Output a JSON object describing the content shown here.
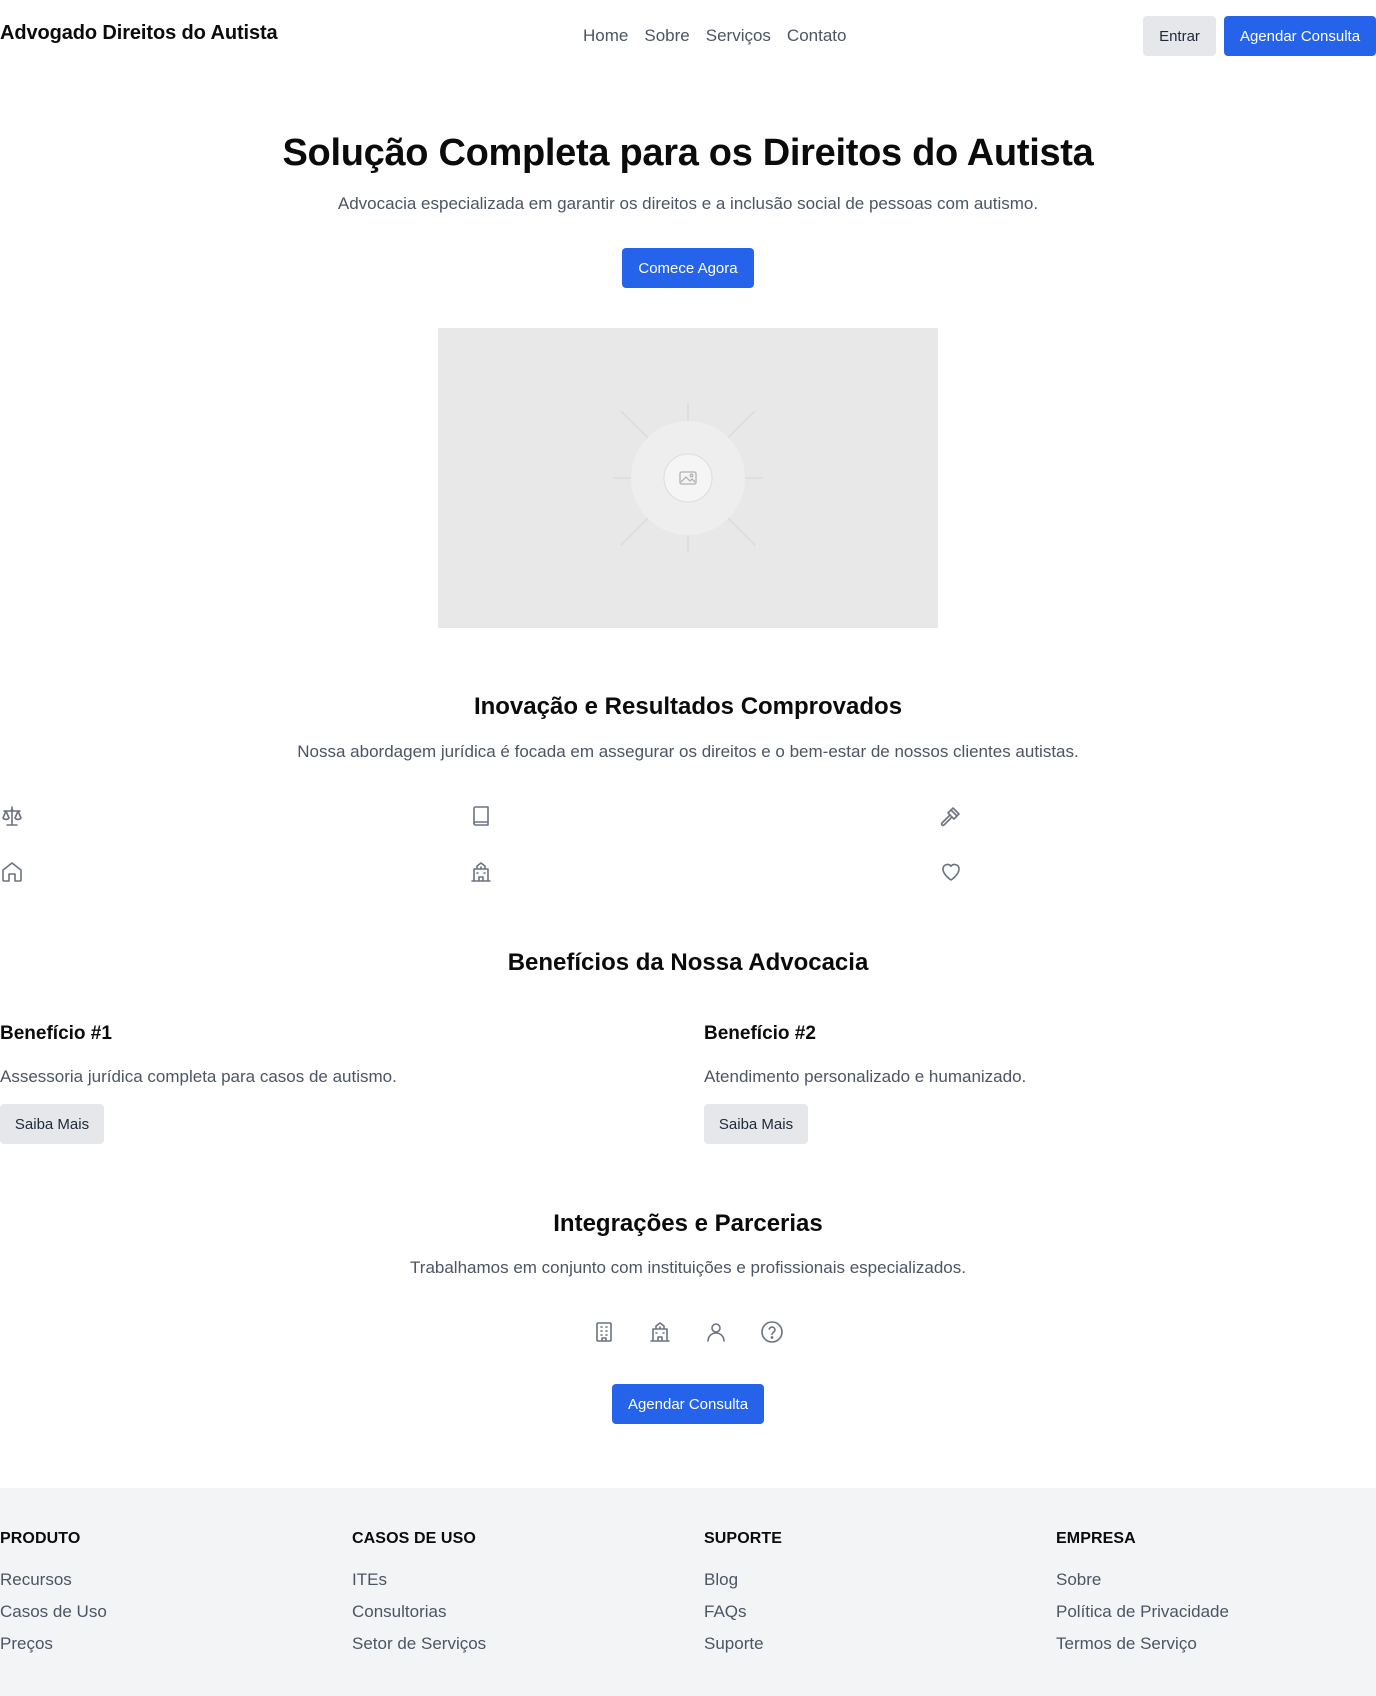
{
  "header": {
    "brand": "Advogado Direitos do Autista",
    "nav": [
      "Home",
      "Sobre",
      "Serviços",
      "Contato"
    ],
    "login_label": "Entrar",
    "cta_label": "Agendar Consulta"
  },
  "hero": {
    "title": "Solução Completa para os Direitos do Autista",
    "subtitle": "Advocacia especializada em garantir os direitos e a inclusão social de pessoas com autismo.",
    "cta_label": "Comece Agora",
    "image_icon": "image-placeholder-icon"
  },
  "features": {
    "title": "Inovação e Resultados Comprovados",
    "subtitle": "Nossa abordagem jurídica é focada em assegurar os direitos e o bem-estar de nossos clientes autistas.",
    "icons": [
      "scale-icon",
      "book-icon",
      "gavel-icon",
      "home-icon",
      "school-icon",
      "heart-icon"
    ]
  },
  "benefits": {
    "title": "Benefícios da Nossa Advocacia",
    "items": [
      {
        "title": "Benefício #1",
        "text": "Assessoria jurídica completa para casos de autismo.",
        "button": "Saiba Mais"
      },
      {
        "title": "Benefício #2",
        "text": "Atendimento personalizado e humanizado.",
        "button": "Saiba Mais"
      }
    ]
  },
  "integrations": {
    "title": "Integrações e Parcerias",
    "subtitle": "Trabalhamos em conjunto com instituições e profissionais especializados.",
    "icons": [
      "building-icon",
      "school-icon",
      "user-icon",
      "help-circle-icon"
    ],
    "cta_label": "Agendar Consulta"
  },
  "footer": {
    "columns": [
      {
        "heading": "PRODUTO",
        "links": [
          "Recursos",
          "Casos de Uso",
          "Preços"
        ]
      },
      {
        "heading": "CASOS DE USO",
        "links": [
          "ITEs",
          "Consultorias",
          "Setor de Serviços"
        ]
      },
      {
        "heading": "SUPORTE",
        "links": [
          "Blog",
          "FAQs",
          "Suporte"
        ]
      },
      {
        "heading": "EMPRESA",
        "links": [
          "Sobre",
          "Política de Privacidade",
          "Termos de Serviço"
        ]
      }
    ]
  },
  "colors": {
    "primary": "#2563eb",
    "secondary_button": "#e5e7eb",
    "muted_text": "#4b5563",
    "footer_bg": "#f3f4f6"
  }
}
